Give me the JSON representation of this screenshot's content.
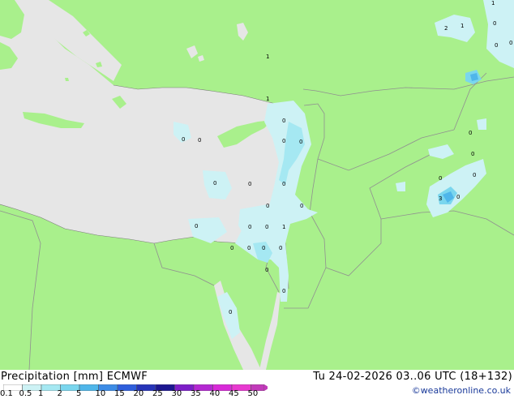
{
  "header": {
    "variable": "Precipitation [mm]",
    "model": "ECMWF",
    "valid_time": "Tu 24-02-2026 03..06 UTC (18+132)",
    "credit": "©weatheronline.co.uk"
  },
  "legend": {
    "labels": [
      "0.1",
      "0.5",
      "1",
      "2",
      "5",
      "10",
      "15",
      "20",
      "25",
      "30",
      "35",
      "40",
      "45",
      "50"
    ],
    "colors": [
      "#ffffff",
      "#cdf2f5",
      "#a5e8f2",
      "#7ad6ee",
      "#4fb6ea",
      "#3c8ce6",
      "#2e5edc",
      "#2634b8",
      "#1c1790",
      "#7d1ec8",
      "#b428d2",
      "#d82ad8",
      "#e83ad0",
      "#c23aba"
    ]
  },
  "map": {
    "land_color": "#a9f08c",
    "sea_color": "#e6e6e6",
    "precip_light": "#cdf2f5",
    "precip_mid": "#a5e8f2",
    "precip_heavy": "#4fb6ea",
    "values": [
      "1",
      "1",
      "2",
      "1",
      "0",
      "0",
      "0",
      "1",
      "0",
      "0",
      "0",
      "0",
      "0",
      "0",
      "0",
      "0",
      "0",
      "0",
      "0",
      "0",
      "0",
      "0",
      "0",
      "0",
      "0",
      "1",
      "0",
      "0",
      "0",
      "0",
      "0",
      "3",
      "0",
      "0",
      "0"
    ]
  }
}
